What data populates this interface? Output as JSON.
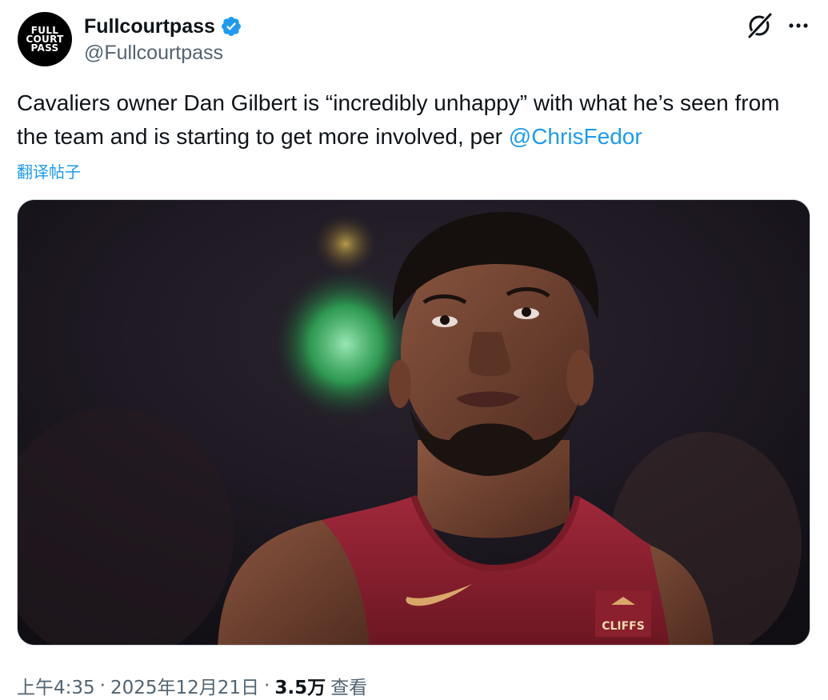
{
  "author": {
    "display_name": "Fullcourtpass",
    "handle": "@Fullcourtpass",
    "avatar_text": [
      "FULL",
      "COURT",
      "PASS"
    ],
    "verified_color": "#1d9bf0"
  },
  "tweet": {
    "text_before_mention": "Cavaliers owner Dan Gilbert is “incredibly unhappy” with what he’s seen from the team and is starting to get more involved, per ",
    "mention": "@ChrisFedor",
    "translate_label": "翻译帖子",
    "image_alt": "Basketball player in a red Cavaliers jersey looking upward",
    "jersey_sponsor": "CLIFFS"
  },
  "meta": {
    "time": "上午4:35",
    "date": "2025年12月21日",
    "separator": "·",
    "views_count": "3.5万",
    "views_label": "查看"
  },
  "icons": {
    "grok": "grok-icon",
    "more": "more-icon",
    "verified": "verified-badge-icon"
  },
  "colors": {
    "accent": "#1d9bf0",
    "text": "#0f1419",
    "secondary": "#536471",
    "jersey": "#8e1f2c"
  }
}
